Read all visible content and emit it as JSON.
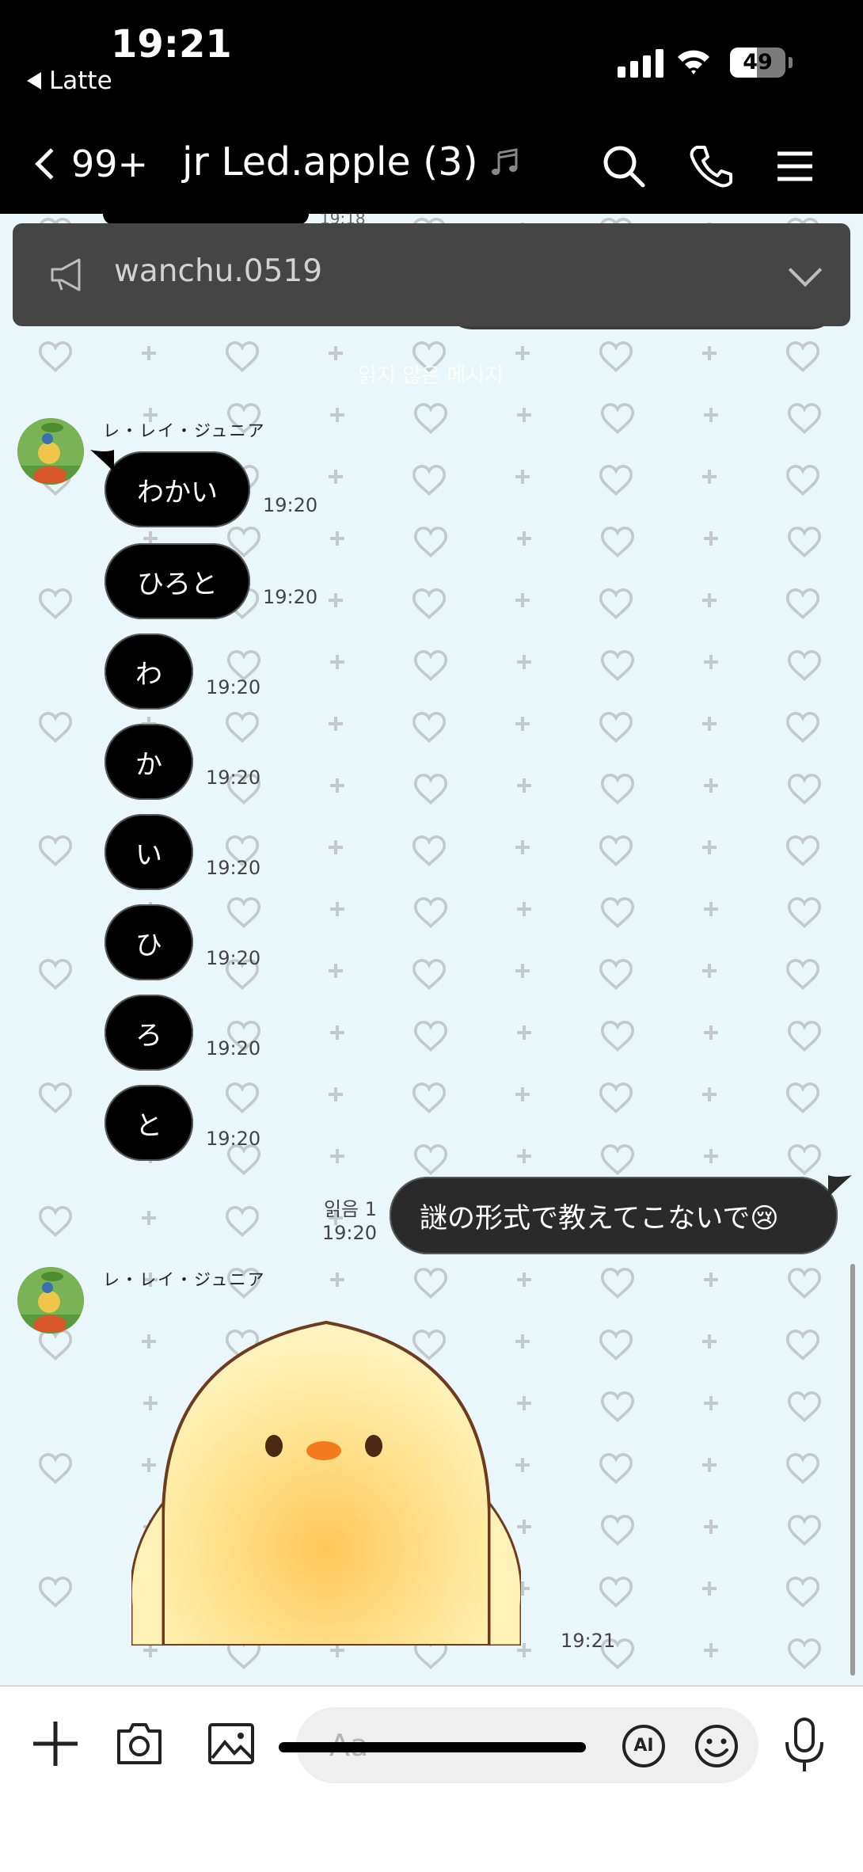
{
  "status_bar": {
    "time": "19:21",
    "back_app": "Latte",
    "battery": "49"
  },
  "header": {
    "back_count": "99+",
    "title": "jr Led.apple (3)"
  },
  "overlay": {
    "notice_text": "읽지 않은 메시지"
  },
  "announcement": {
    "text": "wanchu.0519"
  },
  "messages": [
    {
      "sender": "レ・レイ・ジュニア"
    },
    {
      "text": "わかい",
      "time": "19:20"
    },
    {
      "text": "ひろと",
      "time": "19:20"
    },
    {
      "text": "わ",
      "time": "19:20"
    },
    {
      "text": "か",
      "time": "19:20"
    },
    {
      "text": "い",
      "time": "19:20"
    },
    {
      "text": "ひ",
      "time": "19:20"
    },
    {
      "text": "ろ",
      "time": "19:20"
    },
    {
      "text": "と",
      "time": "19:20"
    }
  ],
  "own_message": {
    "text": "謎の形式で教えてこないで😢",
    "read": "읽음 1",
    "time": "19:20"
  },
  "second_sender": "レ・レイ・ジュニア",
  "sticker_time": "19:21",
  "stale": {
    "time": "19:18"
  },
  "input": {
    "placeholder": "Aa",
    "ai_label": "AI"
  },
  "icons": {
    "back": "chevron-left-icon",
    "music": "music-note-icon",
    "search": "search-icon",
    "call": "phone-icon",
    "menu": "menu-icon",
    "announce": "megaphone-icon",
    "add": "plus-icon",
    "camera": "camera-icon",
    "gallery": "image-icon",
    "emoji": "emoji-icon",
    "mic": "microphone-icon"
  },
  "colors": {
    "chat_bg": "#e9f6fa",
    "bubble": "#000000",
    "own_bubble": "#2a2a2a",
    "announce_bg": "#454545"
  }
}
